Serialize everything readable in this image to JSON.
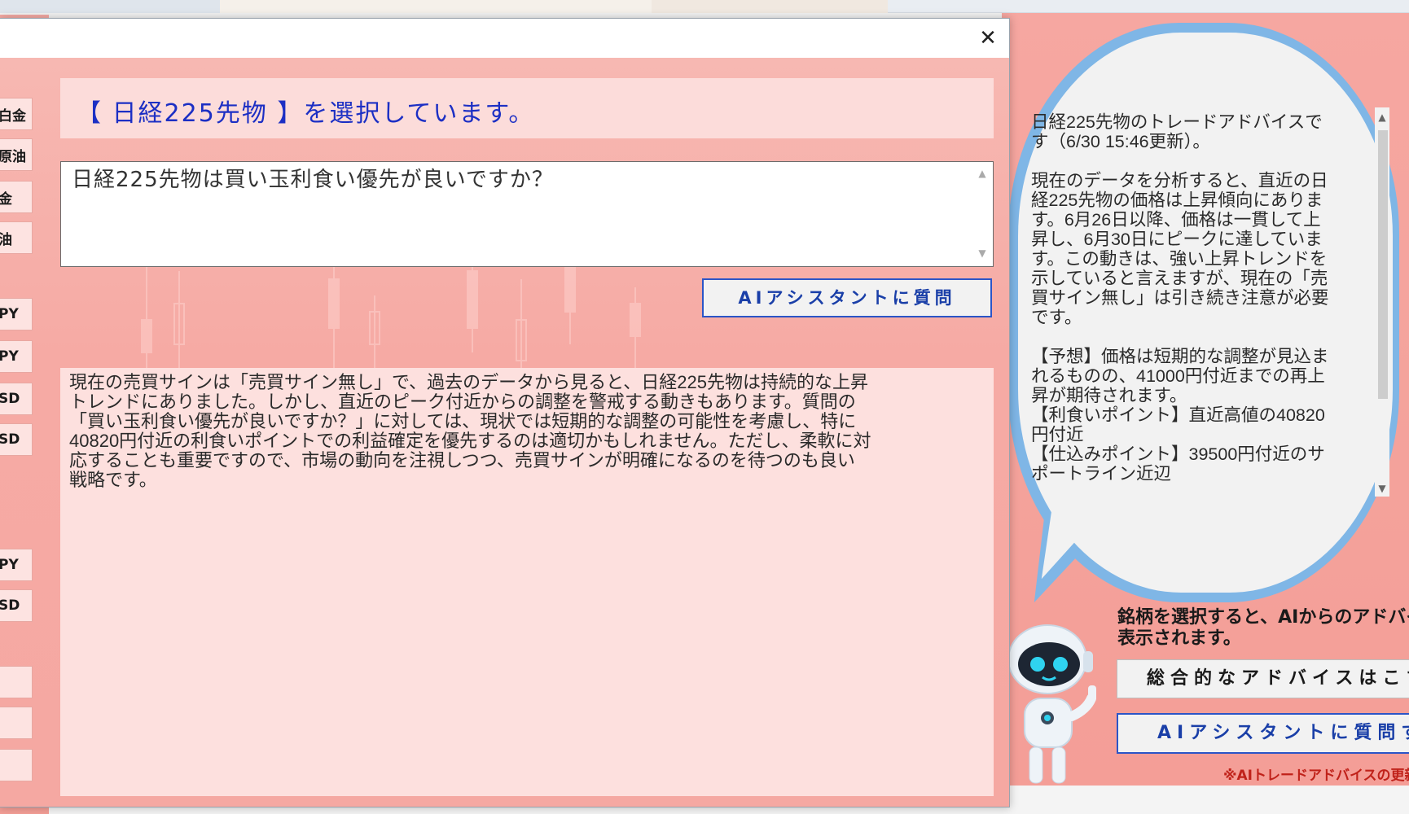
{
  "dialog": {
    "title_message": "【 日経225先物 】を選択しています。",
    "question_text": "日経225先物は買い玉利食い優先が良いですか？",
    "ask_button": "AIアシスタントに質問",
    "answer_text": "現在の売買サインは「売買サイン無し」で、過去のデータから見ると、日経225先物は持続的な上昇\nトレンドにありました。しかし、直近のピーク付近からの調整を警戒する動きもあります。質問の\n「買い玉利食い優先が良いですか？」に対しては、現状では短期的な調整の可能性を考慮し、特に\n40820円付近の利食いポイントでの利益確定を優先するのは適切かもしれません。ただし、柔軟に対\n応することも重要ですので、市場の動向を注視しつつ、売買サインが明確になるのを待つのも良い\n戦略です。",
    "close_icon": "close-icon"
  },
  "left_panel": {
    "buttons": [
      "白金",
      "原油",
      "金",
      "油",
      "PY",
      "PY",
      "SD",
      "SD",
      "PY",
      "SD",
      "",
      "",
      ""
    ]
  },
  "advice_panel": {
    "text": "日経225先物のトレードアドバイスで\nす（6/30 15:46更新）。\n\n現在のデータを分析すると、直近の日\n経225先物の価格は上昇傾向にありま\nす。6月26日以降、価格は一貫して上\n昇し、6月30日にピークに達していま\nす。この動きは、強い上昇トレンドを\n示していると言えますが、現在の「売\n買サイン無し」は引き続き注意が必要\nです。\n\n【予想】価格は短期的な調整が見込ま\nれるものの、41000円付近までの再上\n昇が期待されます。\n【利食いポイント】直近高値の40820\n円付近\n【仕込みポイント】39500円付近のサ\nポートライン近辺",
    "hint": "銘柄を選択すると、AIからのアドバイ\n表示されます。",
    "overall_button": "総合的なアドバイスはこちら",
    "ask_button": "AIアシスタントに質問する",
    "notice": "※AIトレードアドバイスの更新"
  },
  "colors": {
    "accent_blue": "#1c2fc4",
    "button_border": "#2b55c7",
    "notice_red": "#c0221a",
    "panel_pink": "#fcdcda"
  }
}
